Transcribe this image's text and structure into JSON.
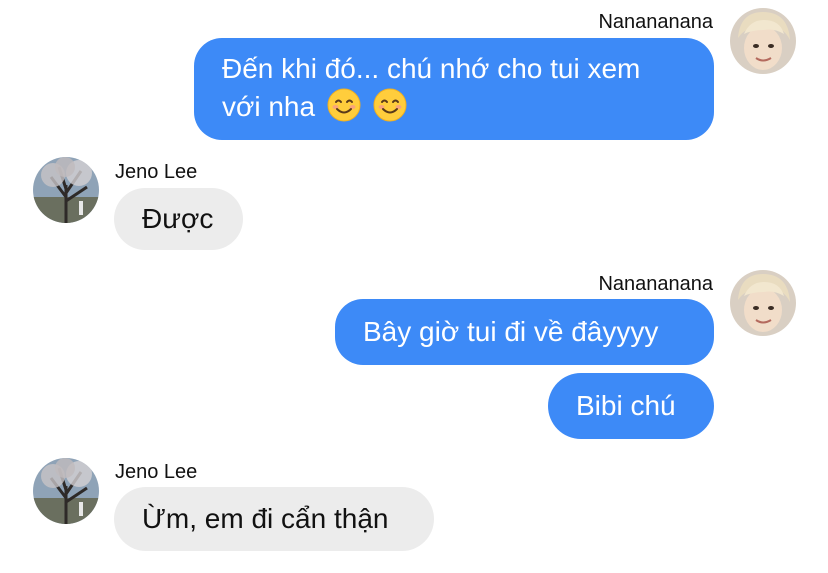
{
  "chat": {
    "messages": [
      {
        "sender": "Nanananana",
        "direction": "outgoing",
        "text_line1": "Đến khi đó... chú nhớ cho tui xem",
        "text_line2": "với nha",
        "emojis": [
          "smiling-face-icon",
          "smiling-face-icon"
        ]
      },
      {
        "sender": "Jeno Lee",
        "direction": "incoming",
        "text": "Được"
      },
      {
        "sender": "Nanananana",
        "direction": "outgoing",
        "text": "Bây giờ tui đi về đâyyyy"
      },
      {
        "sender": "Nanananana",
        "direction": "outgoing",
        "text": "Bibi chú"
      },
      {
        "sender": "Jeno Lee",
        "direction": "incoming",
        "text": "Ừm, em đi cẩn thận"
      }
    ]
  },
  "colors": {
    "outgoing_bubble": "#3d8af7",
    "incoming_bubble": "#ececec",
    "background": "#ffffff"
  }
}
